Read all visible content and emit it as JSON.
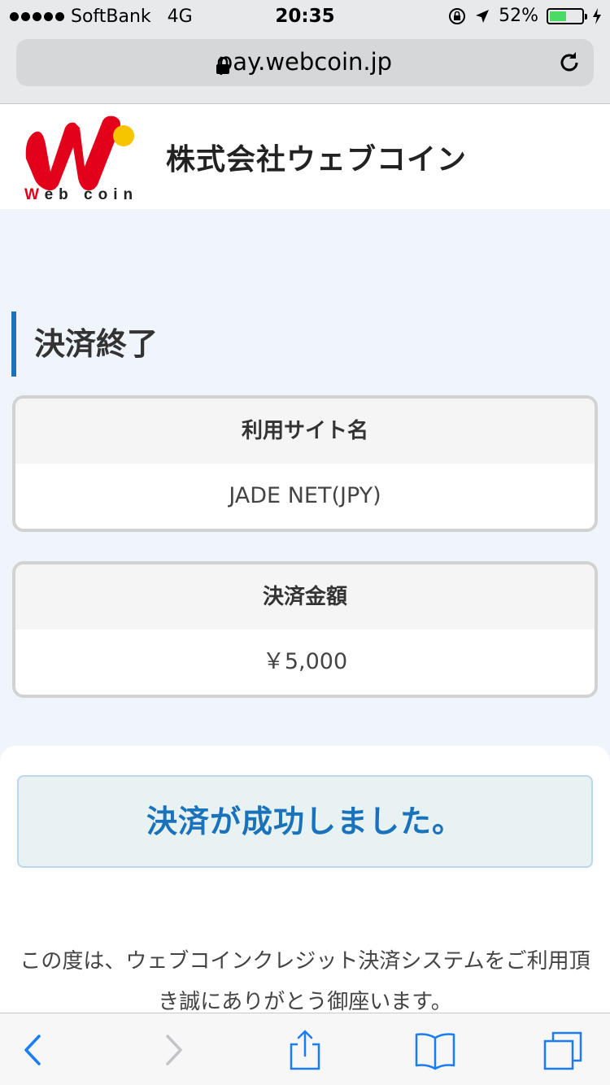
{
  "status_bar": {
    "carrier": "SoftBank",
    "network": "4G",
    "time": "20:35",
    "battery": "52%",
    "battery_level": 0.52
  },
  "browser": {
    "url": "pay.webcoin.jp"
  },
  "header": {
    "logo_text": "Web coin",
    "company_name": "株式会社ウェブコイン"
  },
  "main": {
    "section_title": "決済終了",
    "site_card": {
      "label": "利用サイト名",
      "value": "JADE NET(JPY)"
    },
    "amount_card": {
      "label": "決済金額",
      "value": "￥5,000"
    }
  },
  "result": {
    "message": "決済が成功しました。",
    "thanks": "この度は、ウェブコインクレジット決済システムをご利用頂き誠にありがとう御座います。"
  },
  "colors": {
    "accent": "#1a72bb",
    "battery_green": "#4cd964",
    "page_bg": "#f0f5fb"
  },
  "icons": [
    "lock-icon",
    "reload-icon",
    "back-icon",
    "forward-icon",
    "share-icon",
    "bookmarks-icon",
    "tabs-icon",
    "location-arrow-icon",
    "orientation-lock-icon",
    "charging-icon"
  ]
}
